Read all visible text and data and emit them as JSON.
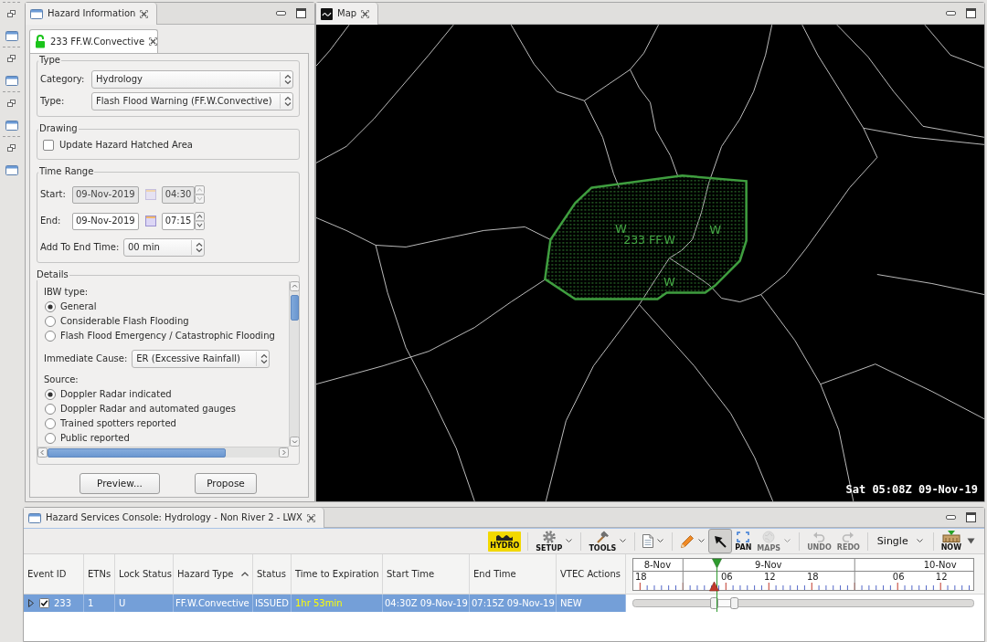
{
  "hazard_information": {
    "title": "Hazard Information",
    "tab": {
      "label": "233 FF.W.Convective",
      "locked": false
    },
    "type_group": {
      "legend": "Type",
      "fields": [
        {
          "label": "Category:",
          "value": "Hydrology"
        },
        {
          "label": "Type:",
          "value": "Flash Flood Warning (FF.W.Convective)"
        }
      ]
    },
    "drawing_group": {
      "legend": "Drawing",
      "checkbox": {
        "label": "Update Hazard Hatched Area",
        "checked": false
      }
    },
    "time_range": {
      "legend": "Time Range",
      "rows": [
        {
          "label": "Start:",
          "date": "09-Nov-2019",
          "time": "04:30",
          "disabled": true
        },
        {
          "label": "End:",
          "date": "09-Nov-2019",
          "time": "07:15",
          "disabled": false
        }
      ],
      "add_to_end": {
        "label": "Add To End Time:",
        "value": "00 min"
      }
    },
    "details": {
      "legend": "Details",
      "items": [
        {
          "kind": "heading",
          "text": "IBW type:"
        },
        {
          "kind": "radio",
          "label": "General",
          "selected": true
        },
        {
          "kind": "radio",
          "label": "Considerable Flash Flooding",
          "selected": false
        },
        {
          "kind": "radio",
          "label": "Flash Flood Emergency / Catastrophic Flooding",
          "selected": false
        },
        {
          "kind": "select",
          "label": "Immediate Cause:",
          "value": "ER (Excessive Rainfall)"
        },
        {
          "kind": "heading",
          "text": "Source:"
        },
        {
          "kind": "radio",
          "label": "Doppler Radar indicated",
          "selected": true
        },
        {
          "kind": "radio",
          "label": "Doppler Radar and automated gauges",
          "selected": false
        },
        {
          "kind": "radio",
          "label": "Trained spotters reported",
          "selected": false
        },
        {
          "kind": "radio",
          "label": "Public reported",
          "selected": false
        }
      ]
    },
    "buttons": [
      "Preview...",
      "Propose"
    ]
  },
  "map": {
    "title": "Map",
    "hazard": {
      "label": "233 FF.W",
      "markers": [
        "W",
        "W",
        "W"
      ]
    },
    "timestamp": "Sat 05:08Z 09-Nov-19"
  },
  "console": {
    "title": "Hazard Services Console: Hydrology - Non River 2 - LWX",
    "toolbar": [
      {
        "kind": "hydro",
        "label": "HYDRO",
        "dropdown": false,
        "disabled": false,
        "selected": false
      },
      {
        "kind": "separator"
      },
      {
        "kind": "setup",
        "label": "SETUP",
        "dropdown": true,
        "disabled": false,
        "selected": false
      },
      {
        "kind": "separator"
      },
      {
        "kind": "tools",
        "label": "TOOLS",
        "dropdown": true,
        "disabled": false,
        "selected": false
      },
      {
        "kind": "separator"
      },
      {
        "kind": "document",
        "dropdown": true,
        "disabled": false,
        "selected": false
      },
      {
        "kind": "separator"
      },
      {
        "kind": "pencil",
        "dropdown": true,
        "disabled": false,
        "selected": false
      },
      {
        "kind": "select",
        "dropdown": false,
        "disabled": false,
        "selected": true
      },
      {
        "kind": "pan",
        "label": "PAN",
        "dropdown": false,
        "disabled": false,
        "selected": false
      },
      {
        "kind": "maps",
        "label": "MAPS",
        "dropdown": true,
        "disabled": true,
        "selected": false
      },
      {
        "kind": "separator"
      },
      {
        "kind": "undo",
        "label": "UNDO",
        "dropdown": false,
        "disabled": true,
        "selected": false
      },
      {
        "kind": "redo",
        "label": "REDO",
        "dropdown": false,
        "disabled": true,
        "selected": false
      },
      {
        "kind": "separator"
      },
      {
        "kind": "mode",
        "label": "Single",
        "dropdown": true,
        "disabled": false,
        "selected": false
      },
      {
        "kind": "separator"
      },
      {
        "kind": "now",
        "label": "NOW",
        "dropdown": false,
        "disabled": false,
        "selected": false
      },
      {
        "kind": "menu",
        "dropdown": false,
        "disabled": false,
        "selected": false
      }
    ],
    "columns": [
      {
        "label": "Event ID",
        "sorted": false
      },
      {
        "label": "ETNs",
        "sorted": false
      },
      {
        "label": "Lock Status",
        "sorted": false
      },
      {
        "label": "Hazard Type",
        "sorted": true
      },
      {
        "label": "Status",
        "sorted": false
      },
      {
        "label": "Time to Expiration",
        "sorted": false
      },
      {
        "label": "Start Time",
        "sorted": false
      },
      {
        "label": "End Time",
        "sorted": false
      },
      {
        "label": "VTEC Actions",
        "sorted": false
      }
    ],
    "timeline": {
      "days": [
        {
          "label": "8-Nov",
          "hours": [
            "18"
          ]
        },
        {
          "label": "9-Nov",
          "hours": [
            "06",
            "12",
            "18"
          ]
        },
        {
          "label": "10-Nov",
          "hours": [
            "06",
            "12"
          ]
        }
      ]
    },
    "rows": [
      {
        "expanded": false,
        "checked": true,
        "selected": true,
        "cells": [
          "233",
          "1",
          "U",
          "FF.W.Convective",
          "ISSUED",
          "1hr 53min",
          "04:30Z 09-Nov-19",
          "07:15Z 09-Nov-19",
          "NEW"
        ]
      }
    ]
  }
}
